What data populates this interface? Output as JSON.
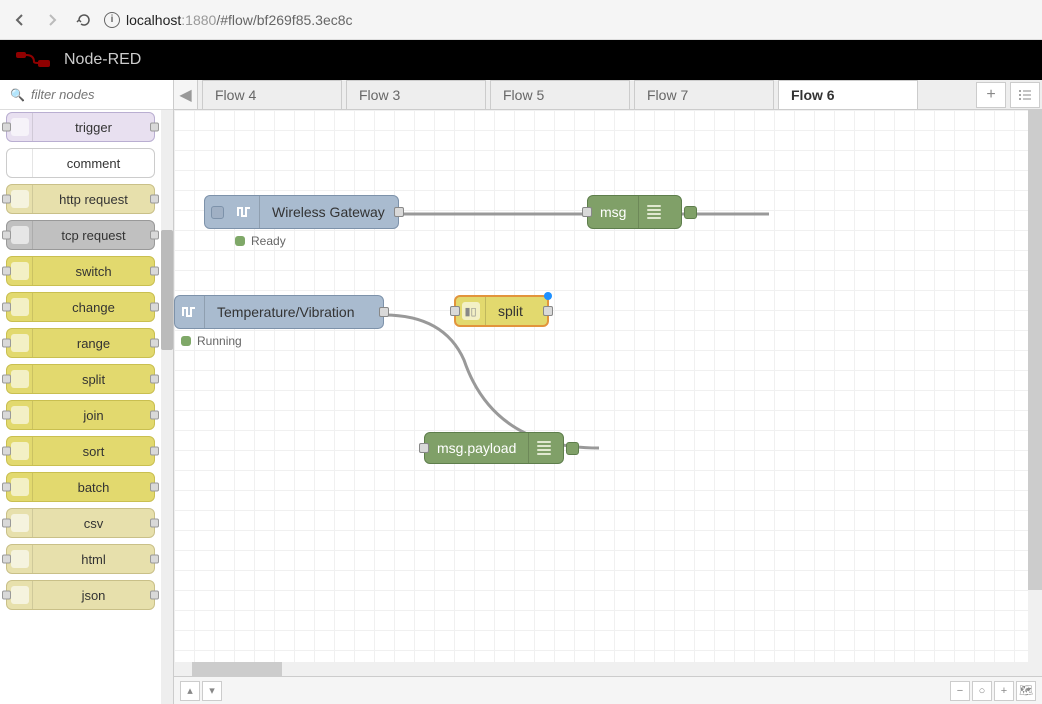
{
  "browser": {
    "url_host": "localhost",
    "url_port": ":1880",
    "url_hash": "/#flow/bf269f85.3ec8c"
  },
  "header": {
    "title": "Node-RED"
  },
  "palette": {
    "filter_placeholder": "filter nodes",
    "nodes": [
      {
        "label": "trigger",
        "color": "c-lavender",
        "ports": "lr"
      },
      {
        "label": "comment",
        "color": "c-white",
        "ports": "none"
      },
      {
        "label": "http request",
        "color": "c-tan",
        "ports": "lr"
      },
      {
        "label": "tcp request",
        "color": "c-gray",
        "ports": "lr"
      },
      {
        "label": "switch",
        "color": "c-yellow",
        "ports": "lr"
      },
      {
        "label": "change",
        "color": "c-yellow",
        "ports": "lr"
      },
      {
        "label": "range",
        "color": "c-yellow",
        "ports": "lr"
      },
      {
        "label": "split",
        "color": "c-yellow",
        "ports": "lr"
      },
      {
        "label": "join",
        "color": "c-yellow",
        "ports": "lr"
      },
      {
        "label": "sort",
        "color": "c-yellow",
        "ports": "lr"
      },
      {
        "label": "batch",
        "color": "c-yellow",
        "ports": "lr"
      },
      {
        "label": "csv",
        "color": "c-tan",
        "ports": "lr"
      },
      {
        "label": "html",
        "color": "c-tan",
        "ports": "lr"
      },
      {
        "label": "json",
        "color": "c-tan",
        "ports": "lr"
      }
    ]
  },
  "tabs": [
    {
      "label": "Flow 4",
      "active": false
    },
    {
      "label": "Flow 3",
      "active": false
    },
    {
      "label": "Flow 5",
      "active": false
    },
    {
      "label": "Flow 7",
      "active": false
    },
    {
      "label": "Flow 6",
      "active": true
    }
  ],
  "canvas": {
    "nodes": {
      "gateway": {
        "label": "Wireless Gateway",
        "status": "Ready",
        "status_color": "#7fa868"
      },
      "msg": {
        "label": "msg"
      },
      "tempvib": {
        "label": "Temperature/Vibration",
        "status": "Running",
        "status_color": "#7fa868"
      },
      "split": {
        "label": "split"
      },
      "payload": {
        "label": "msg.payload"
      }
    }
  }
}
